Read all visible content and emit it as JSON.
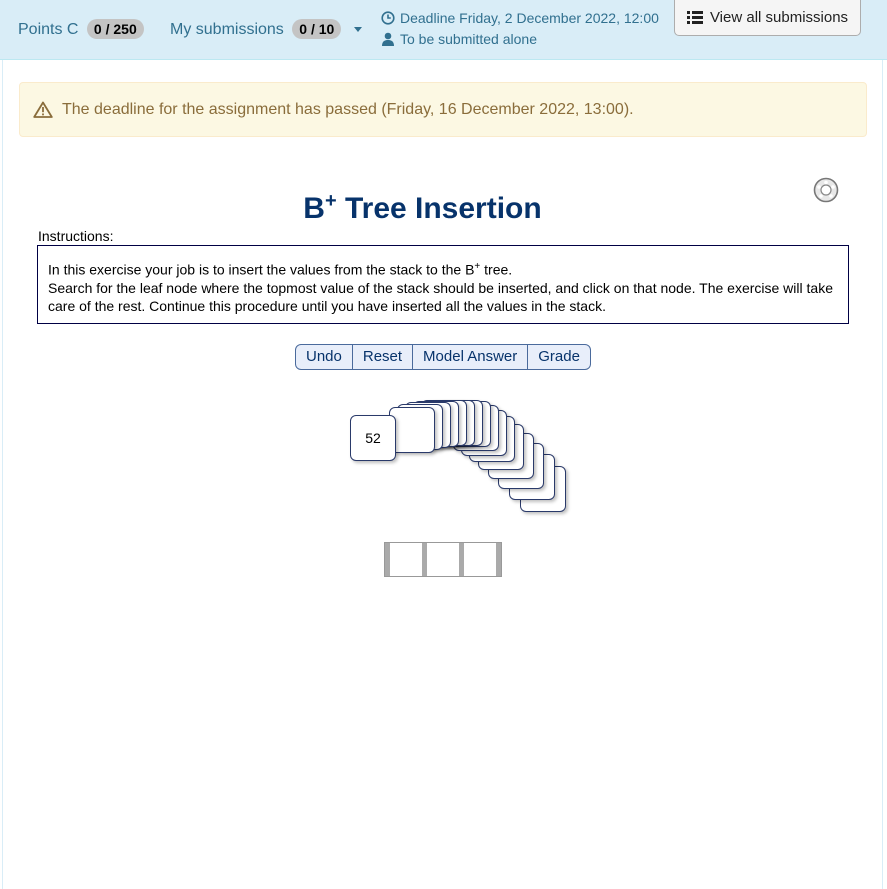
{
  "topbar": {
    "points_label": "Points C",
    "points_value": "0 / 250",
    "submissions_label": "My submissions",
    "submissions_value": "0 / 10",
    "deadline_text": "Deadline Friday, 2 December 2022, 12:00",
    "submit_mode_text": "To be submitted alone",
    "view_all_label": "View all submissions"
  },
  "alert": {
    "text": "The deadline for the assignment has passed (Friday, 16 December 2022, 13:00)."
  },
  "exercise": {
    "title_main": "B",
    "title_sup": "+",
    "title_rest": " Tree Insertion",
    "instructions_label": "Instructions:",
    "instr_line1_pre": "In this exercise your job is to insert the values from the stack to the B",
    "instr_line1_sup": "+",
    "instr_line1_post": " tree.",
    "instr_line2": "Search for the leaf node where the topmost value of the stack should be inserted, and click on that node. The exercise will take care of the rest. Continue this procedure until you have inserted all the values in the stack.",
    "buttons": {
      "undo": "Undo",
      "reset": "Reset",
      "model_answer": "Model Answer",
      "grade": "Grade"
    },
    "stack_top_value": "52",
    "stack_hidden_cards": 16,
    "leaf_cells": 3
  },
  "colors": {
    "topbar_bg": "#d9edf7",
    "topbar_text": "#31708f",
    "alert_bg": "#fcf8e3",
    "alert_text": "#8a6d3b",
    "title": "#07336b"
  },
  "icons": [
    "clock-icon",
    "user-icon",
    "list-icon",
    "warning-icon",
    "settings-icon"
  ]
}
